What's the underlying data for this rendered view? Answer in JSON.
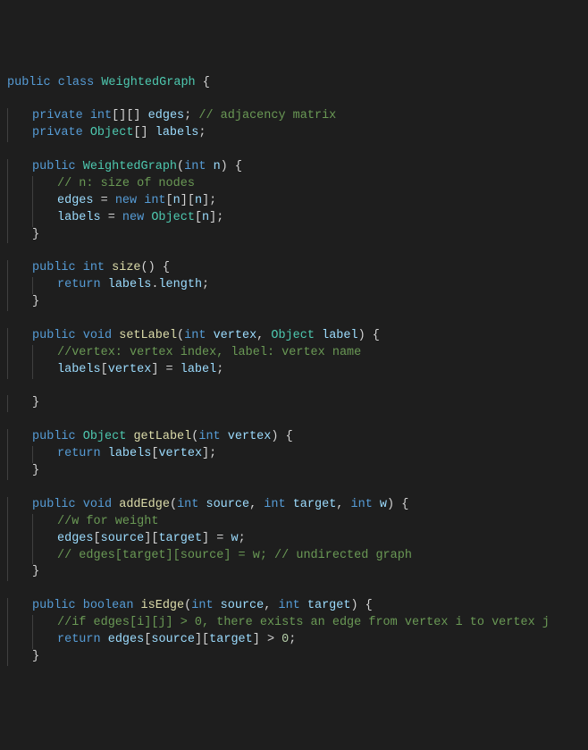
{
  "code": {
    "lines": [
      {
        "ind": 0,
        "tokens": [
          {
            "t": "public ",
            "c": "k-blue"
          },
          {
            "t": "class ",
            "c": "k-blue"
          },
          {
            "t": "WeightedGraph",
            "c": "cls"
          },
          {
            "t": " {",
            "c": "punct"
          }
        ]
      },
      {
        "ind": 0,
        "tokens": []
      },
      {
        "ind": 1,
        "tokens": [
          {
            "t": "private ",
            "c": "k-blue"
          },
          {
            "t": "int",
            "c": "k-blue"
          },
          {
            "t": "[][] ",
            "c": "punct"
          },
          {
            "t": "edges",
            "c": "var"
          },
          {
            "t": "; ",
            "c": "punct"
          },
          {
            "t": "// adjacency matrix",
            "c": "comment"
          }
        ]
      },
      {
        "ind": 1,
        "tokens": [
          {
            "t": "private ",
            "c": "k-blue"
          },
          {
            "t": "Object",
            "c": "cls"
          },
          {
            "t": "[] ",
            "c": "punct"
          },
          {
            "t": "labels",
            "c": "var"
          },
          {
            "t": ";",
            "c": "punct"
          }
        ]
      },
      {
        "ind": 0,
        "tokens": []
      },
      {
        "ind": 1,
        "tokens": [
          {
            "t": "public ",
            "c": "k-blue"
          },
          {
            "t": "WeightedGraph",
            "c": "cls"
          },
          {
            "t": "(",
            "c": "punct"
          },
          {
            "t": "int ",
            "c": "k-blue"
          },
          {
            "t": "n",
            "c": "var"
          },
          {
            "t": ") {",
            "c": "punct"
          }
        ]
      },
      {
        "ind": 2,
        "tokens": [
          {
            "t": "// n: size of nodes",
            "c": "comment"
          }
        ]
      },
      {
        "ind": 2,
        "tokens": [
          {
            "t": "edges",
            "c": "var"
          },
          {
            "t": " = ",
            "c": "punct"
          },
          {
            "t": "new ",
            "c": "k-blue"
          },
          {
            "t": "int",
            "c": "k-blue"
          },
          {
            "t": "[",
            "c": "punct"
          },
          {
            "t": "n",
            "c": "var"
          },
          {
            "t": "][",
            "c": "punct"
          },
          {
            "t": "n",
            "c": "var"
          },
          {
            "t": "];",
            "c": "punct"
          }
        ]
      },
      {
        "ind": 2,
        "tokens": [
          {
            "t": "labels",
            "c": "var"
          },
          {
            "t": " = ",
            "c": "punct"
          },
          {
            "t": "new ",
            "c": "k-blue"
          },
          {
            "t": "Object",
            "c": "cls"
          },
          {
            "t": "[",
            "c": "punct"
          },
          {
            "t": "n",
            "c": "var"
          },
          {
            "t": "];",
            "c": "punct"
          }
        ]
      },
      {
        "ind": 1,
        "tokens": [
          {
            "t": "}",
            "c": "punct"
          }
        ]
      },
      {
        "ind": 0,
        "tokens": []
      },
      {
        "ind": 1,
        "tokens": [
          {
            "t": "public ",
            "c": "k-blue"
          },
          {
            "t": "int ",
            "c": "k-blue"
          },
          {
            "t": "size",
            "c": "fn"
          },
          {
            "t": "() {",
            "c": "punct"
          }
        ]
      },
      {
        "ind": 2,
        "tokens": [
          {
            "t": "return ",
            "c": "k-blue"
          },
          {
            "t": "labels",
            "c": "var"
          },
          {
            "t": ".",
            "c": "punct"
          },
          {
            "t": "length",
            "c": "var"
          },
          {
            "t": ";",
            "c": "punct"
          }
        ]
      },
      {
        "ind": 1,
        "tokens": [
          {
            "t": "}",
            "c": "punct"
          }
        ]
      },
      {
        "ind": 0,
        "tokens": []
      },
      {
        "ind": 1,
        "tokens": [
          {
            "t": "public ",
            "c": "k-blue"
          },
          {
            "t": "void ",
            "c": "k-blue"
          },
          {
            "t": "setLabel",
            "c": "fn"
          },
          {
            "t": "(",
            "c": "punct"
          },
          {
            "t": "int ",
            "c": "k-blue"
          },
          {
            "t": "vertex",
            "c": "var"
          },
          {
            "t": ", ",
            "c": "punct"
          },
          {
            "t": "Object ",
            "c": "cls"
          },
          {
            "t": "label",
            "c": "var"
          },
          {
            "t": ") {",
            "c": "punct"
          }
        ]
      },
      {
        "ind": 2,
        "tokens": [
          {
            "t": "//vertex: vertex index, label: vertex name",
            "c": "comment"
          }
        ]
      },
      {
        "ind": 2,
        "tokens": [
          {
            "t": "labels",
            "c": "var"
          },
          {
            "t": "[",
            "c": "punct"
          },
          {
            "t": "vertex",
            "c": "var"
          },
          {
            "t": "] = ",
            "c": "punct"
          },
          {
            "t": "label",
            "c": "var"
          },
          {
            "t": ";",
            "c": "punct"
          }
        ]
      },
      {
        "ind": 0,
        "tokens": []
      },
      {
        "ind": 1,
        "tokens": [
          {
            "t": "}",
            "c": "punct"
          }
        ]
      },
      {
        "ind": 0,
        "tokens": []
      },
      {
        "ind": 1,
        "tokens": [
          {
            "t": "public ",
            "c": "k-blue"
          },
          {
            "t": "Object ",
            "c": "cls"
          },
          {
            "t": "getLabel",
            "c": "fn"
          },
          {
            "t": "(",
            "c": "punct"
          },
          {
            "t": "int ",
            "c": "k-blue"
          },
          {
            "t": "vertex",
            "c": "var"
          },
          {
            "t": ") {",
            "c": "punct"
          }
        ]
      },
      {
        "ind": 2,
        "tokens": [
          {
            "t": "return ",
            "c": "k-blue"
          },
          {
            "t": "labels",
            "c": "var"
          },
          {
            "t": "[",
            "c": "punct"
          },
          {
            "t": "vertex",
            "c": "var"
          },
          {
            "t": "];",
            "c": "punct"
          }
        ]
      },
      {
        "ind": 1,
        "tokens": [
          {
            "t": "}",
            "c": "punct"
          }
        ]
      },
      {
        "ind": 0,
        "tokens": []
      },
      {
        "ind": 1,
        "tokens": [
          {
            "t": "public ",
            "c": "k-blue"
          },
          {
            "t": "void ",
            "c": "k-blue"
          },
          {
            "t": "addEdge",
            "c": "fn"
          },
          {
            "t": "(",
            "c": "punct"
          },
          {
            "t": "int ",
            "c": "k-blue"
          },
          {
            "t": "source",
            "c": "var"
          },
          {
            "t": ", ",
            "c": "punct"
          },
          {
            "t": "int ",
            "c": "k-blue"
          },
          {
            "t": "target",
            "c": "var"
          },
          {
            "t": ", ",
            "c": "punct"
          },
          {
            "t": "int ",
            "c": "k-blue"
          },
          {
            "t": "w",
            "c": "var"
          },
          {
            "t": ") {",
            "c": "punct"
          }
        ]
      },
      {
        "ind": 2,
        "tokens": [
          {
            "t": "//w for weight",
            "c": "comment"
          }
        ]
      },
      {
        "ind": 2,
        "tokens": [
          {
            "t": "edges",
            "c": "var"
          },
          {
            "t": "[",
            "c": "punct"
          },
          {
            "t": "source",
            "c": "var"
          },
          {
            "t": "][",
            "c": "punct"
          },
          {
            "t": "target",
            "c": "var"
          },
          {
            "t": "] = ",
            "c": "punct"
          },
          {
            "t": "w",
            "c": "var"
          },
          {
            "t": ";",
            "c": "punct"
          }
        ]
      },
      {
        "ind": 2,
        "tokens": [
          {
            "t": "// edges[target][source] = w; // undirected graph",
            "c": "comment"
          }
        ]
      },
      {
        "ind": 1,
        "tokens": [
          {
            "t": "}",
            "c": "punct"
          }
        ]
      },
      {
        "ind": 0,
        "tokens": []
      },
      {
        "ind": 1,
        "tokens": [
          {
            "t": "public ",
            "c": "k-blue"
          },
          {
            "t": "boolean ",
            "c": "k-blue"
          },
          {
            "t": "isEdge",
            "c": "fn"
          },
          {
            "t": "(",
            "c": "punct"
          },
          {
            "t": "int ",
            "c": "k-blue"
          },
          {
            "t": "source",
            "c": "var"
          },
          {
            "t": ", ",
            "c": "punct"
          },
          {
            "t": "int ",
            "c": "k-blue"
          },
          {
            "t": "target",
            "c": "var"
          },
          {
            "t": ") {",
            "c": "punct"
          }
        ]
      },
      {
        "ind": 2,
        "tokens": [
          {
            "t": "//if edges[i][j] > 0, there exists an edge from vertex i to vertex j",
            "c": "comment"
          }
        ]
      },
      {
        "ind": 2,
        "tokens": [
          {
            "t": "return ",
            "c": "k-blue"
          },
          {
            "t": "edges",
            "c": "var"
          },
          {
            "t": "[",
            "c": "punct"
          },
          {
            "t": "source",
            "c": "var"
          },
          {
            "t": "][",
            "c": "punct"
          },
          {
            "t": "target",
            "c": "var"
          },
          {
            "t": "] > ",
            "c": "punct"
          },
          {
            "t": "0",
            "c": "num"
          },
          {
            "t": ";",
            "c": "punct"
          }
        ]
      },
      {
        "ind": 1,
        "tokens": [
          {
            "t": "}",
            "c": "punct"
          }
        ]
      }
    ]
  }
}
